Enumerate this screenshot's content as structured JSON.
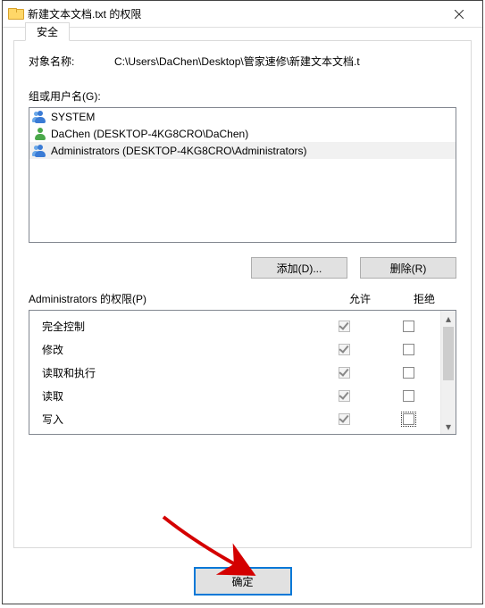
{
  "window": {
    "title": "新建文本文档.txt 的权限",
    "close_tooltip": "关闭"
  },
  "tab": {
    "label": "安全"
  },
  "object": {
    "label": "对象名称:",
    "path": "C:\\Users\\DaChen\\Desktop\\管家速修\\新建文本文档.t"
  },
  "groups": {
    "label": "组或用户名(G):",
    "items": [
      {
        "icon": "users-icon",
        "style": "blue multi",
        "text": "SYSTEM"
      },
      {
        "icon": "user-icon",
        "style": "green",
        "text": "DaChen (DESKTOP-4KG8CRO\\DaChen)"
      },
      {
        "icon": "users-icon",
        "style": "blue multi",
        "text": "Administrators (DESKTOP-4KG8CRO\\Administrators)",
        "selected": true
      }
    ]
  },
  "buttons": {
    "add": "添加(D)...",
    "remove": "删除(R)",
    "ok": "确定"
  },
  "perm": {
    "header_label": "Administrators 的权限(P)",
    "col_allow": "允许",
    "col_deny": "拒绝",
    "rows": [
      {
        "name": "完全控制",
        "allow": true,
        "deny": false
      },
      {
        "name": "修改",
        "allow": true,
        "deny": false
      },
      {
        "name": "读取和执行",
        "allow": true,
        "deny": false
      },
      {
        "name": "读取",
        "allow": true,
        "deny": false
      },
      {
        "name": "写入",
        "allow": true,
        "deny": false,
        "deny_focus": true
      }
    ]
  }
}
